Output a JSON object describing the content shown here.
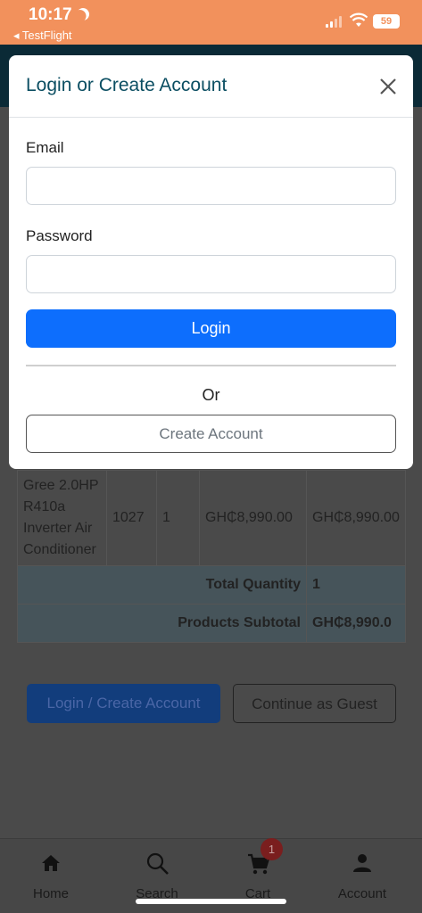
{
  "status_bar": {
    "time": "10:17",
    "back_app": "◂ TestFlight",
    "battery": "59"
  },
  "modal": {
    "title": "Login or Create Account",
    "email_label": "Email",
    "email_value": "",
    "password_label": "Password",
    "password_value": "",
    "login_label": "Login",
    "or_text": "Or",
    "create_account_label": "Create Account"
  },
  "cart": {
    "item": {
      "name": "Gree 2.0HP R410a Inverter Air Conditioner",
      "code": "1027",
      "quantity": "1",
      "price": "GH₵8,990.00",
      "total": "GH₵8,990.00"
    },
    "total_quantity_label": "Total Quantity",
    "total_quantity_value": "1",
    "subtotal_label": "Products Subtotal",
    "subtotal_value": "GH₵8,990.0"
  },
  "actions": {
    "login_create_label": "Login / Create Account",
    "guest_label": "Continue as Guest"
  },
  "bottom_nav": {
    "items": [
      {
        "label": "Home",
        "icon": "home-icon"
      },
      {
        "label": "Search",
        "icon": "search-icon"
      },
      {
        "label": "Cart",
        "icon": "cart-icon"
      },
      {
        "label": "Account",
        "icon": "account-icon"
      }
    ],
    "cart_badge": "1"
  },
  "colors": {
    "status_bar": "#f2915c",
    "primary": "#0d6efd",
    "title": "#0b4e62"
  }
}
